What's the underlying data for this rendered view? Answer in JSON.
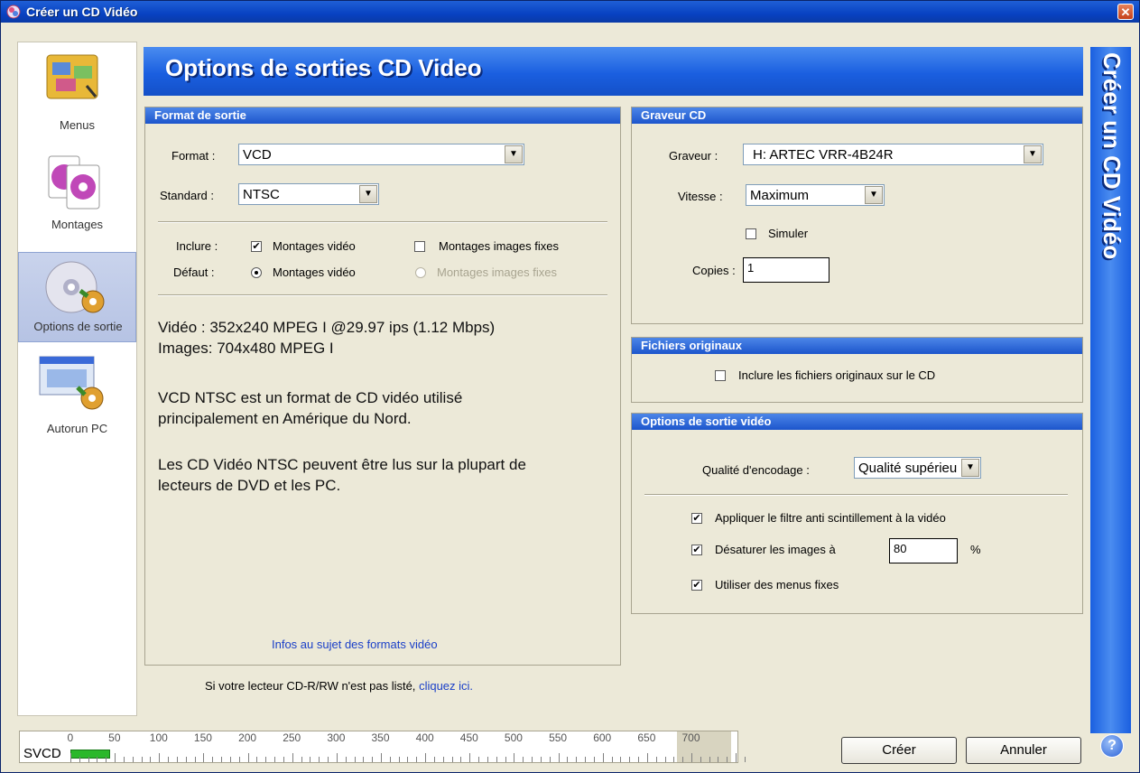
{
  "window": {
    "title": "Créer un CD Vidéo",
    "close_glyph": "✕"
  },
  "sidebar": {
    "items": [
      {
        "label": "Menus",
        "icon": "menus-icon"
      },
      {
        "label": "Montages",
        "icon": "montages-icon"
      },
      {
        "label": "Options de sortie",
        "icon": "options-de-sortie-icon",
        "active": true
      },
      {
        "label": "Autorun PC",
        "icon": "autorun-pc-icon"
      }
    ]
  },
  "banner": {
    "title": "Options de sorties CD Video",
    "side_title": "Créer un CD Vidéo"
  },
  "format_panel": {
    "header": "Format de sortie",
    "format_label": "Format :",
    "format_value": "VCD",
    "standard_label": "Standard :",
    "standard_value": "NTSC",
    "include_label": "Inclure :",
    "include_video": "Montages vidéo",
    "include_video_checked": true,
    "include_stills": "Montages images fixes",
    "include_stills_checked": false,
    "default_label": "Défaut :",
    "default_video": "Montages vidéo",
    "default_stills": "Montages images fixes",
    "info_line1": "Vidéo : 352x240 MPEG I @29.97 ips (1.12 Mbps)",
    "info_line2": "Images: 704x480 MPEG I",
    "desc1_line1": "VCD NTSC est un format de CD vidéo utilisé",
    "desc1_line2": "principalement en Amérique du Nord.",
    "desc2_line1": "Les CD Vidéo NTSC peuvent être lus sur la plupart de",
    "desc2_line2": "lecteurs de DVD et les PC.",
    "info_link": "Infos au sujet des formats vidéo"
  },
  "burner_panel": {
    "header": "Graveur CD",
    "burner_label": "Graveur :",
    "burner_value": "H: ARTEC VRR-4B24R",
    "speed_label": "Vitesse :",
    "speed_value": "Maximum",
    "simulate_label": "Simuler",
    "simulate_checked": false,
    "copies_label": "Copies :",
    "copies_value": "1"
  },
  "originals_panel": {
    "header": "Fichiers originaux",
    "include_label": "Inclure les fichiers originaux sur le CD",
    "include_checked": false
  },
  "video_panel": {
    "header": "Options de sortie vidéo",
    "quality_label": "Qualité d'encodage :",
    "quality_value": "Qualité supérieu",
    "flicker_label": "Appliquer le filtre anti scintillement à la vidéo",
    "flicker_checked": true,
    "desaturate_label": "Désaturer les images à",
    "desaturate_checked": true,
    "desaturate_value": "80",
    "desaturate_unit": "%",
    "fixed_menus_label": "Utiliser des menus fixes",
    "fixed_menus_checked": true
  },
  "footer": {
    "not_listed_text": "Si votre lecteur CD-R/RW n'est pas listé,",
    "not_listed_link": "cliquez ici."
  },
  "capacity": {
    "label": "SVCD",
    "ticks": [
      "0",
      "50",
      "100",
      "150",
      "200",
      "250",
      "300",
      "350",
      "400",
      "450",
      "500",
      "550",
      "600",
      "650",
      "700"
    ],
    "used_mb": 45,
    "max_mb": 700
  },
  "buttons": {
    "create": "Créer",
    "cancel": "Annuler"
  },
  "colors": {
    "accent": "#1a5fe0",
    "panel_header": "#1c55cc",
    "link": "#1a3fc8",
    "capacity_fill": "#2ab82a"
  }
}
